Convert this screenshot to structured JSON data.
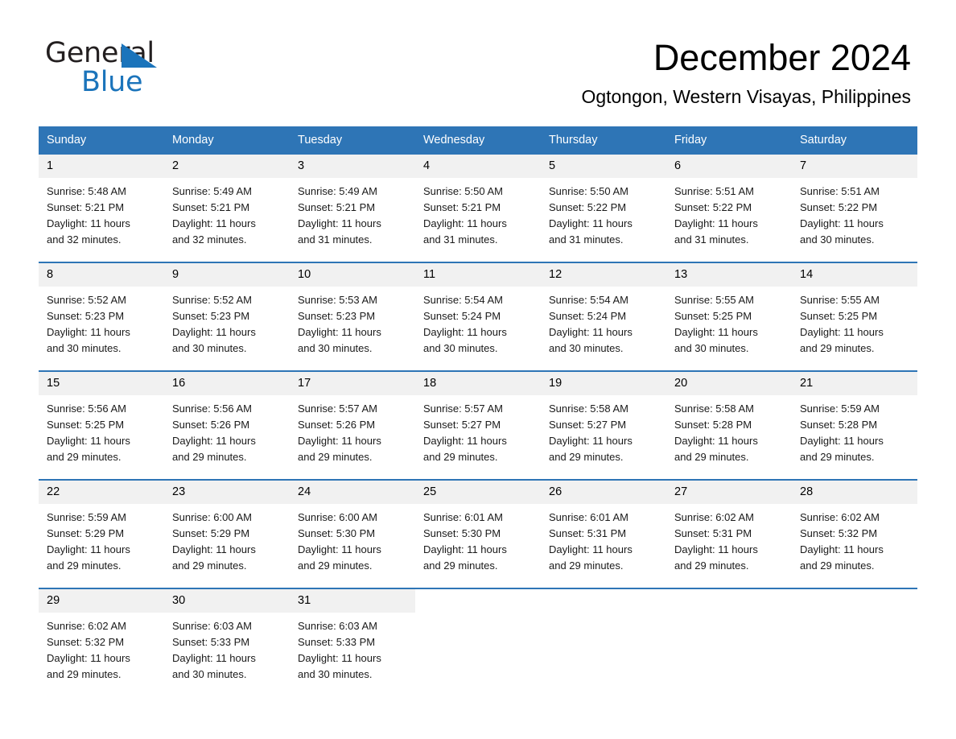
{
  "brand": {
    "name_top": "General",
    "name_bottom": "Blue",
    "triangle_color": "#1b74bb"
  },
  "header": {
    "title": "December 2024",
    "subtitle": "Ogtongon, Western Visayas, Philippines"
  },
  "colors": {
    "header_row": "#2e75b6",
    "daynum_band": "#f1f1f1",
    "rule": "#2e75b6",
    "text": "#000000",
    "header_text": "#ffffff"
  },
  "weekdays": [
    "Sunday",
    "Monday",
    "Tuesday",
    "Wednesday",
    "Thursday",
    "Friday",
    "Saturday"
  ],
  "labels": {
    "sunrise": "Sunrise:",
    "sunset": "Sunset:",
    "daylight": "Daylight:"
  },
  "weeks": [
    [
      {
        "day": "1",
        "sunrise": "Sunrise: 5:48 AM",
        "sunset": "Sunset: 5:21 PM",
        "daylight_a": "Daylight: 11 hours",
        "daylight_b": "and 32 minutes."
      },
      {
        "day": "2",
        "sunrise": "Sunrise: 5:49 AM",
        "sunset": "Sunset: 5:21 PM",
        "daylight_a": "Daylight: 11 hours",
        "daylight_b": "and 32 minutes."
      },
      {
        "day": "3",
        "sunrise": "Sunrise: 5:49 AM",
        "sunset": "Sunset: 5:21 PM",
        "daylight_a": "Daylight: 11 hours",
        "daylight_b": "and 31 minutes."
      },
      {
        "day": "4",
        "sunrise": "Sunrise: 5:50 AM",
        "sunset": "Sunset: 5:21 PM",
        "daylight_a": "Daylight: 11 hours",
        "daylight_b": "and 31 minutes."
      },
      {
        "day": "5",
        "sunrise": "Sunrise: 5:50 AM",
        "sunset": "Sunset: 5:22 PM",
        "daylight_a": "Daylight: 11 hours",
        "daylight_b": "and 31 minutes."
      },
      {
        "day": "6",
        "sunrise": "Sunrise: 5:51 AM",
        "sunset": "Sunset: 5:22 PM",
        "daylight_a": "Daylight: 11 hours",
        "daylight_b": "and 31 minutes."
      },
      {
        "day": "7",
        "sunrise": "Sunrise: 5:51 AM",
        "sunset": "Sunset: 5:22 PM",
        "daylight_a": "Daylight: 11 hours",
        "daylight_b": "and 30 minutes."
      }
    ],
    [
      {
        "day": "8",
        "sunrise": "Sunrise: 5:52 AM",
        "sunset": "Sunset: 5:23 PM",
        "daylight_a": "Daylight: 11 hours",
        "daylight_b": "and 30 minutes."
      },
      {
        "day": "9",
        "sunrise": "Sunrise: 5:52 AM",
        "sunset": "Sunset: 5:23 PM",
        "daylight_a": "Daylight: 11 hours",
        "daylight_b": "and 30 minutes."
      },
      {
        "day": "10",
        "sunrise": "Sunrise: 5:53 AM",
        "sunset": "Sunset: 5:23 PM",
        "daylight_a": "Daylight: 11 hours",
        "daylight_b": "and 30 minutes."
      },
      {
        "day": "11",
        "sunrise": "Sunrise: 5:54 AM",
        "sunset": "Sunset: 5:24 PM",
        "daylight_a": "Daylight: 11 hours",
        "daylight_b": "and 30 minutes."
      },
      {
        "day": "12",
        "sunrise": "Sunrise: 5:54 AM",
        "sunset": "Sunset: 5:24 PM",
        "daylight_a": "Daylight: 11 hours",
        "daylight_b": "and 30 minutes."
      },
      {
        "day": "13",
        "sunrise": "Sunrise: 5:55 AM",
        "sunset": "Sunset: 5:25 PM",
        "daylight_a": "Daylight: 11 hours",
        "daylight_b": "and 30 minutes."
      },
      {
        "day": "14",
        "sunrise": "Sunrise: 5:55 AM",
        "sunset": "Sunset: 5:25 PM",
        "daylight_a": "Daylight: 11 hours",
        "daylight_b": "and 29 minutes."
      }
    ],
    [
      {
        "day": "15",
        "sunrise": "Sunrise: 5:56 AM",
        "sunset": "Sunset: 5:25 PM",
        "daylight_a": "Daylight: 11 hours",
        "daylight_b": "and 29 minutes."
      },
      {
        "day": "16",
        "sunrise": "Sunrise: 5:56 AM",
        "sunset": "Sunset: 5:26 PM",
        "daylight_a": "Daylight: 11 hours",
        "daylight_b": "and 29 minutes."
      },
      {
        "day": "17",
        "sunrise": "Sunrise: 5:57 AM",
        "sunset": "Sunset: 5:26 PM",
        "daylight_a": "Daylight: 11 hours",
        "daylight_b": "and 29 minutes."
      },
      {
        "day": "18",
        "sunrise": "Sunrise: 5:57 AM",
        "sunset": "Sunset: 5:27 PM",
        "daylight_a": "Daylight: 11 hours",
        "daylight_b": "and 29 minutes."
      },
      {
        "day": "19",
        "sunrise": "Sunrise: 5:58 AM",
        "sunset": "Sunset: 5:27 PM",
        "daylight_a": "Daylight: 11 hours",
        "daylight_b": "and 29 minutes."
      },
      {
        "day": "20",
        "sunrise": "Sunrise: 5:58 AM",
        "sunset": "Sunset: 5:28 PM",
        "daylight_a": "Daylight: 11 hours",
        "daylight_b": "and 29 minutes."
      },
      {
        "day": "21",
        "sunrise": "Sunrise: 5:59 AM",
        "sunset": "Sunset: 5:28 PM",
        "daylight_a": "Daylight: 11 hours",
        "daylight_b": "and 29 minutes."
      }
    ],
    [
      {
        "day": "22",
        "sunrise": "Sunrise: 5:59 AM",
        "sunset": "Sunset: 5:29 PM",
        "daylight_a": "Daylight: 11 hours",
        "daylight_b": "and 29 minutes."
      },
      {
        "day": "23",
        "sunrise": "Sunrise: 6:00 AM",
        "sunset": "Sunset: 5:29 PM",
        "daylight_a": "Daylight: 11 hours",
        "daylight_b": "and 29 minutes."
      },
      {
        "day": "24",
        "sunrise": "Sunrise: 6:00 AM",
        "sunset": "Sunset: 5:30 PM",
        "daylight_a": "Daylight: 11 hours",
        "daylight_b": "and 29 minutes."
      },
      {
        "day": "25",
        "sunrise": "Sunrise: 6:01 AM",
        "sunset": "Sunset: 5:30 PM",
        "daylight_a": "Daylight: 11 hours",
        "daylight_b": "and 29 minutes."
      },
      {
        "day": "26",
        "sunrise": "Sunrise: 6:01 AM",
        "sunset": "Sunset: 5:31 PM",
        "daylight_a": "Daylight: 11 hours",
        "daylight_b": "and 29 minutes."
      },
      {
        "day": "27",
        "sunrise": "Sunrise: 6:02 AM",
        "sunset": "Sunset: 5:31 PM",
        "daylight_a": "Daylight: 11 hours",
        "daylight_b": "and 29 minutes."
      },
      {
        "day": "28",
        "sunrise": "Sunrise: 6:02 AM",
        "sunset": "Sunset: 5:32 PM",
        "daylight_a": "Daylight: 11 hours",
        "daylight_b": "and 29 minutes."
      }
    ],
    [
      {
        "day": "29",
        "sunrise": "Sunrise: 6:02 AM",
        "sunset": "Sunset: 5:32 PM",
        "daylight_a": "Daylight: 11 hours",
        "daylight_b": "and 29 minutes."
      },
      {
        "day": "30",
        "sunrise": "Sunrise: 6:03 AM",
        "sunset": "Sunset: 5:33 PM",
        "daylight_a": "Daylight: 11 hours",
        "daylight_b": "and 30 minutes."
      },
      {
        "day": "31",
        "sunrise": "Sunrise: 6:03 AM",
        "sunset": "Sunset: 5:33 PM",
        "daylight_a": "Daylight: 11 hours",
        "daylight_b": "and 30 minutes."
      },
      {
        "day": "",
        "sunrise": "",
        "sunset": "",
        "daylight_a": "",
        "daylight_b": ""
      },
      {
        "day": "",
        "sunrise": "",
        "sunset": "",
        "daylight_a": "",
        "daylight_b": ""
      },
      {
        "day": "",
        "sunrise": "",
        "sunset": "",
        "daylight_a": "",
        "daylight_b": ""
      },
      {
        "day": "",
        "sunrise": "",
        "sunset": "",
        "daylight_a": "",
        "daylight_b": ""
      }
    ]
  ]
}
